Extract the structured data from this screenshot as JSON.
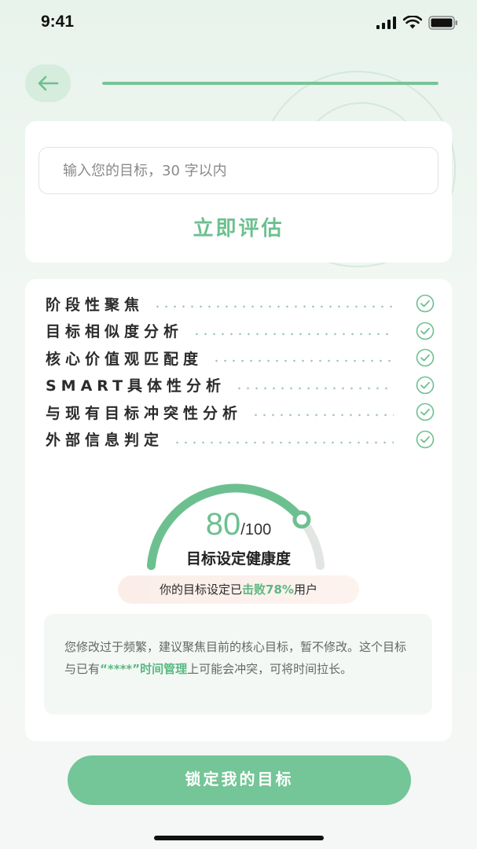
{
  "status_bar": {
    "time": "9:41"
  },
  "header": {
    "progress": 1.0
  },
  "goal_card": {
    "input_value": "",
    "input_placeholder": "输入您的目标，30 字以内",
    "evaluate_label": "立即评估"
  },
  "checks": [
    {
      "label": "阶段性聚焦",
      "done": true
    },
    {
      "label": "目标相似度分析",
      "done": true
    },
    {
      "label": "核心价值观匹配度",
      "done": true
    },
    {
      "label": "SMART具体性分析",
      "done": true
    },
    {
      "label": "与现有目标冲突性分析",
      "done": true
    },
    {
      "label": "外部信息判定",
      "done": true
    }
  ],
  "score": {
    "value": "80",
    "total": "/100",
    "label": "目标设定健康度",
    "fraction": 0.8
  },
  "rank": {
    "prefix": "你的目标设定已",
    "highlight": "击败78%",
    "suffix": "用户"
  },
  "advice": {
    "part1": "您修改过于频繁，建议聚焦目前的核心目标，暂不修改。这个目标与已有",
    "highlight": "“****”时间管理",
    "part2": "上可能会冲突，可将时间拉长。"
  },
  "footer": {
    "lock_label": "锁定我的目标"
  },
  "colors": {
    "accent": "#6cc08f",
    "button": "#74c597",
    "track": "#e2e6e3"
  },
  "icons": {
    "back": "arrow-left-icon",
    "check": "check-circle-icon"
  }
}
